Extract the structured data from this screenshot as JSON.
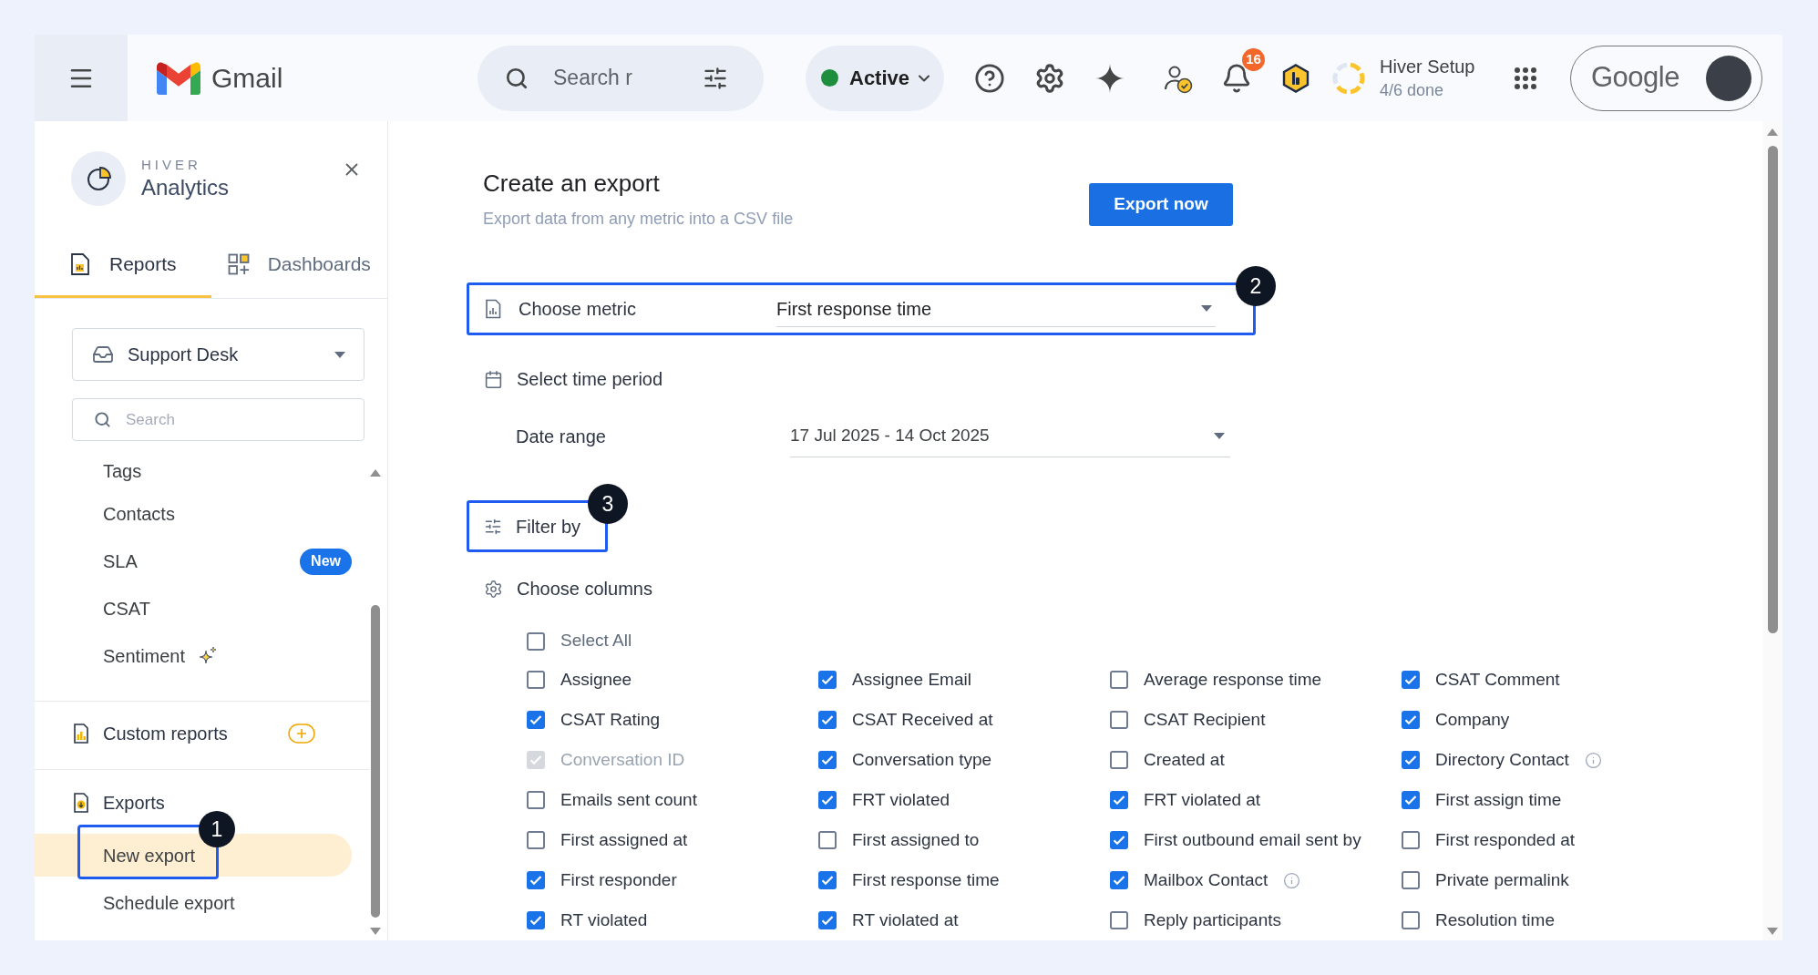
{
  "topbar": {
    "app_name": "Gmail",
    "search": {
      "placeholder": "Search r"
    },
    "status": {
      "label": "Active"
    },
    "notifications": {
      "count": "16"
    },
    "setup": {
      "title": "Hiver Setup",
      "progress": "4/6 done",
      "level": 0.667
    },
    "account": {
      "brand": "Google"
    }
  },
  "sidebar": {
    "brand": "HIVER",
    "title": "Analytics",
    "tabs": [
      {
        "label": "Reports",
        "kind": "report",
        "selected": true
      },
      {
        "label": "Dashboards",
        "kind": "dashboard",
        "selected": false
      }
    ],
    "inbox": {
      "value": "Support Desk"
    },
    "search": {
      "placeholder": "Search"
    },
    "reports": [
      {
        "label": "Tags",
        "kind": "plain",
        "selected": false
      },
      {
        "label": "Contacts",
        "kind": "plain",
        "selected": false
      },
      {
        "label": "SLA",
        "kind": "plain",
        "selected": false,
        "badge": "New"
      },
      {
        "label": "CSAT",
        "kind": "plain",
        "selected": false
      },
      {
        "label": "Sentiment",
        "kind": "ai",
        "selected": false
      }
    ],
    "custom_reports": {
      "label": "Custom reports"
    },
    "exports": {
      "label": "Exports",
      "children": [
        {
          "label": "New export",
          "selected": true,
          "step": "1"
        },
        {
          "label": "Schedule export",
          "selected": false
        }
      ]
    }
  },
  "main": {
    "title": "Create an export",
    "subtitle": "Export data from any metric into a CSV file",
    "primary_button": "Export now",
    "metric": {
      "label": "Choose metric",
      "value": "First response time",
      "step": "2"
    },
    "time_period": {
      "label": "Select time period",
      "field_label": "Date range",
      "value": "17 Jul 2025 - 14 Oct 2025"
    },
    "filter": {
      "label": "Filter by",
      "step": "3"
    },
    "columns": {
      "label": "Choose columns",
      "select_all": {
        "label": "Select All",
        "checked": false
      },
      "items": [
        {
          "label": "Assignee",
          "checked": false,
          "disabled": false
        },
        {
          "label": "Assignee Email",
          "checked": true,
          "disabled": false
        },
        {
          "label": "Average response time",
          "checked": false,
          "disabled": false
        },
        {
          "label": "CSAT Comment",
          "checked": true,
          "disabled": false
        },
        {
          "label": "CSAT Rating",
          "checked": true,
          "disabled": false
        },
        {
          "label": "CSAT Received at",
          "checked": true,
          "disabled": false
        },
        {
          "label": "CSAT Recipient",
          "checked": false,
          "disabled": false
        },
        {
          "label": "Company",
          "checked": true,
          "disabled": false
        },
        {
          "label": "Conversation ID",
          "checked": true,
          "disabled": true
        },
        {
          "label": "Conversation type",
          "checked": true,
          "disabled": false
        },
        {
          "label": "Created at",
          "checked": false,
          "disabled": false
        },
        {
          "label": "Directory Contact",
          "checked": true,
          "disabled": false,
          "info": true
        },
        {
          "label": "Emails sent count",
          "checked": false,
          "disabled": false
        },
        {
          "label": "FRT violated",
          "checked": true,
          "disabled": false
        },
        {
          "label": "FRT violated at",
          "checked": true,
          "disabled": false
        },
        {
          "label": "First assign time",
          "checked": true,
          "disabled": false
        },
        {
          "label": "First assigned at",
          "checked": false,
          "disabled": false
        },
        {
          "label": "First assigned to",
          "checked": false,
          "disabled": false
        },
        {
          "label": "First outbound email sent by",
          "checked": true,
          "disabled": false
        },
        {
          "label": "First responded at",
          "checked": false,
          "disabled": false
        },
        {
          "label": "First responder",
          "checked": true,
          "disabled": false
        },
        {
          "label": "First response time",
          "checked": true,
          "disabled": false
        },
        {
          "label": "Mailbox Contact",
          "checked": true,
          "disabled": false,
          "info": true
        },
        {
          "label": "Private permalink",
          "checked": false,
          "disabled": false
        },
        {
          "label": "RT violated",
          "checked": true,
          "disabled": false
        },
        {
          "label": "RT violated at",
          "checked": true,
          "disabled": false
        },
        {
          "label": "Reply participants",
          "checked": false,
          "disabled": false
        },
        {
          "label": "Resolution time",
          "checked": false,
          "disabled": false
        }
      ]
    }
  }
}
